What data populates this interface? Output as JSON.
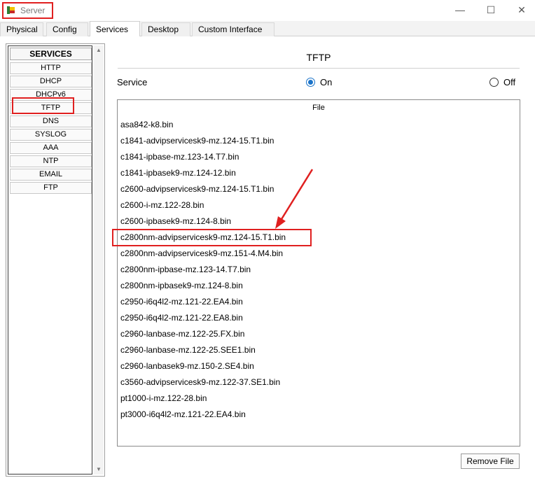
{
  "window": {
    "title": "Server",
    "minimize": "—",
    "maximize": "☐",
    "close": "✕"
  },
  "tabs": [
    {
      "label": "Physical"
    },
    {
      "label": "Config"
    },
    {
      "label": "Services"
    },
    {
      "label": "Desktop"
    },
    {
      "label": "Custom Interface"
    }
  ],
  "sidebar": {
    "header": "SERVICES",
    "items": [
      "HTTP",
      "DHCP",
      "DHCPv6",
      "TFTP",
      "DNS",
      "SYSLOG",
      "AAA",
      "NTP",
      "EMAIL",
      "FTP"
    ],
    "selected": "TFTP"
  },
  "panel": {
    "title": "TFTP",
    "service_label": "Service",
    "on_label": "On",
    "off_label": "Off",
    "service_state": "On",
    "file_header": "File",
    "files": [
      "asa842-k8.bin",
      "c1841-advipservicesk9-mz.124-15.T1.bin",
      "c1841-ipbase-mz.123-14.T7.bin",
      "c1841-ipbasek9-mz.124-12.bin",
      "c2600-advipservicesk9-mz.124-15.T1.bin",
      "c2600-i-mz.122-28.bin",
      "c2600-ipbasek9-mz.124-8.bin",
      "c2800nm-advipservicesk9-mz.124-15.T1.bin",
      "c2800nm-advipservicesk9-mz.151-4.M4.bin",
      "c2800nm-ipbase-mz.123-14.T7.bin",
      "c2800nm-ipbasek9-mz.124-8.bin",
      "c2950-i6q4l2-mz.121-22.EA4.bin",
      "c2950-i6q4l2-mz.121-22.EA8.bin",
      "c2960-lanbase-mz.122-25.FX.bin",
      "c2960-lanbase-mz.122-25.SEE1.bin",
      "c2960-lanbasek9-mz.150-2.SE4.bin",
      "c3560-advipservicesk9-mz.122-37.SE1.bin",
      "pt1000-i-mz.122-28.bin",
      "pt3000-i6q4l2-mz.121-22.EA4.bin"
    ],
    "highlighted_file": "c2800nm-advipservicesk9-mz.124-15.T1.bin",
    "remove_button": "Remove File"
  },
  "colors": {
    "highlight": "#e02020",
    "radio_accent": "#1a73c9"
  }
}
